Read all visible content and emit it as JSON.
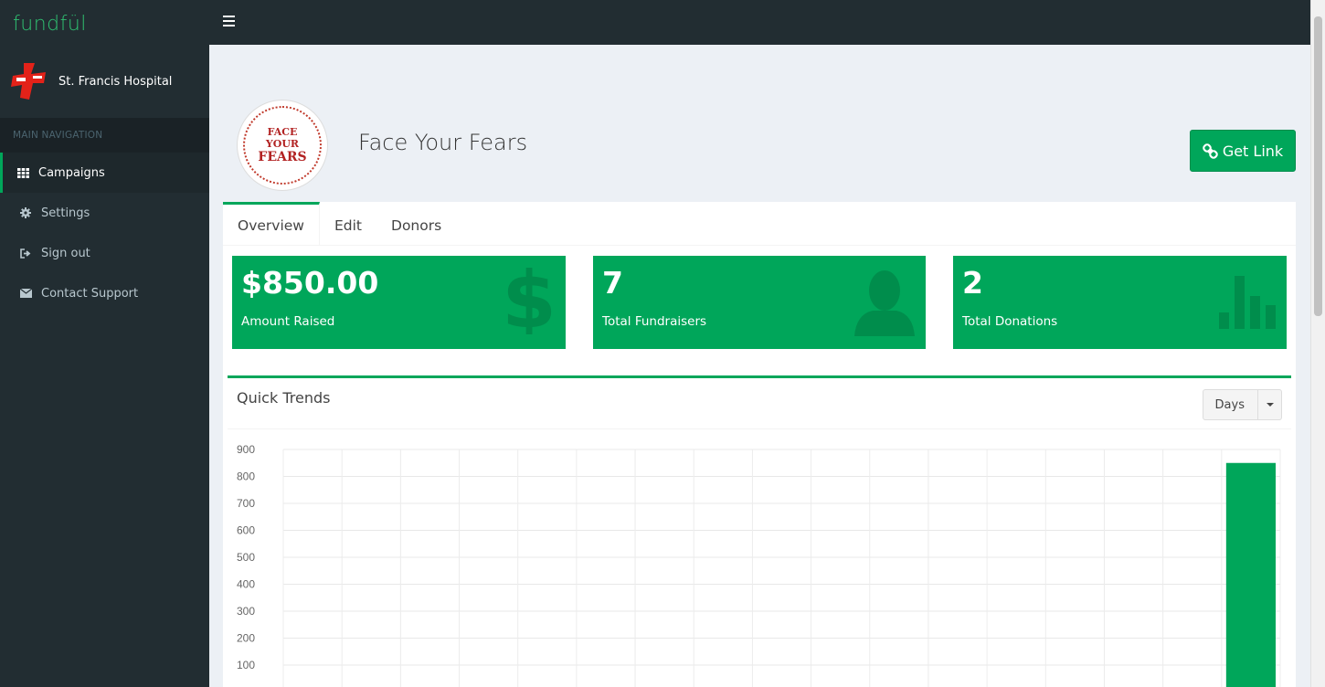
{
  "brand": {
    "logo_text": "fundfül",
    "accent": "#00a65a"
  },
  "org": {
    "name": "St. Francis Hospital"
  },
  "nav": {
    "header": "MAIN NAVIGATION",
    "items": [
      {
        "label": "Campaigns",
        "icon": "grid-icon",
        "active": true
      },
      {
        "label": "Settings",
        "icon": "gear-icon",
        "active": false
      },
      {
        "label": "Sign out",
        "icon": "sign-out-icon",
        "active": false
      },
      {
        "label": "Contact Support",
        "icon": "envelope-icon",
        "active": false
      }
    ]
  },
  "campaign": {
    "title": "Face Your Fears",
    "avatar_lines": [
      "FACE",
      "YOUR",
      "FEARS"
    ],
    "get_link_label": "Get Link"
  },
  "tabs": [
    {
      "label": "Overview",
      "active": true
    },
    {
      "label": "Edit",
      "active": false
    },
    {
      "label": "Donors",
      "active": false
    }
  ],
  "stats": [
    {
      "value": "$850.00",
      "label": "Amount Raised",
      "icon": "dollar-icon"
    },
    {
      "value": "7",
      "label": "Total Fundraisers",
      "icon": "user-icon"
    },
    {
      "value": "2",
      "label": "Total Donations",
      "icon": "bar-chart-icon"
    }
  ],
  "trends": {
    "title": "Quick Trends",
    "period_label": "Days"
  },
  "chart_data": {
    "type": "bar",
    "y_ticks": [
      100,
      200,
      300,
      400,
      500,
      600,
      700,
      800,
      900
    ],
    "ylim": [
      0,
      900
    ],
    "bar_count": 17,
    "values": [
      0,
      0,
      0,
      0,
      0,
      0,
      0,
      0,
      0,
      0,
      0,
      0,
      0,
      0,
      0,
      0,
      850
    ],
    "grid": true,
    "bar_color": "#00a65a"
  }
}
